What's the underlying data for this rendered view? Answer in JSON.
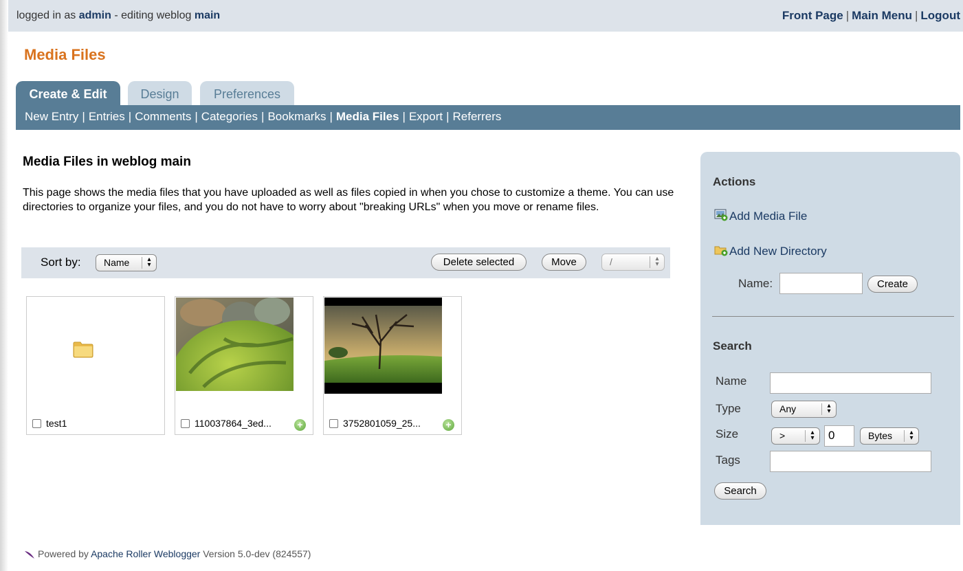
{
  "topbar": {
    "logged_in_prefix": "logged in as",
    "user": "admin",
    "editing_prefix": "- editing weblog",
    "weblog": "main",
    "links": [
      "Front Page",
      "Main Menu",
      "Logout"
    ],
    "separator": "|"
  },
  "page_title": "Media Files",
  "tabs": [
    {
      "label": "Create & Edit",
      "active": true
    },
    {
      "label": "Design",
      "active": false
    },
    {
      "label": "Preferences",
      "active": false
    }
  ],
  "subnav": [
    "New Entry",
    "Entries",
    "Comments",
    "Categories",
    "Bookmarks",
    "Media Files",
    "Export",
    "Referrers"
  ],
  "subnav_current": "Media Files",
  "main": {
    "heading": "Media Files in weblog main",
    "description": "This page shows the media files that you have uploaded as well as files copied in when you chose to customize a theme. You can use directories to organize your files, and you do not have to worry about \"breaking URLs\" when you move or rename files.",
    "toolbar": {
      "sort_label": "Sort by:",
      "sort_value": "Name",
      "delete_label": "Delete selected",
      "move_label": "Move",
      "move_target": "/"
    },
    "files": [
      {
        "name": "test1",
        "kind": "folder-icon"
      },
      {
        "name": "110037864_3ed...",
        "kind": "image"
      },
      {
        "name": "3752801059_25...",
        "kind": "image"
      }
    ]
  },
  "sidebar": {
    "actions_title": "Actions",
    "add_media_file": "Add Media File",
    "add_new_directory": "Add New Directory",
    "name_label": "Name:",
    "name_value": "",
    "create_label": "Create",
    "search_title": "Search",
    "search_name_label": "Name",
    "type_label": "Type",
    "type_value": "Any",
    "size_label": "Size",
    "size_op": ">",
    "size_value": "0",
    "size_unit": "Bytes",
    "tags_label": "Tags",
    "search_button": "Search"
  },
  "footer": {
    "prefix": "Powered by",
    "product": "Apache Roller Weblogger",
    "version": "Version 5.0-dev (824557)"
  },
  "colors": {
    "accent_orange": "#d9731e",
    "nav_blue": "#587d96",
    "panel_blue": "#cfdbe5",
    "link_navy": "#1b3a63"
  }
}
